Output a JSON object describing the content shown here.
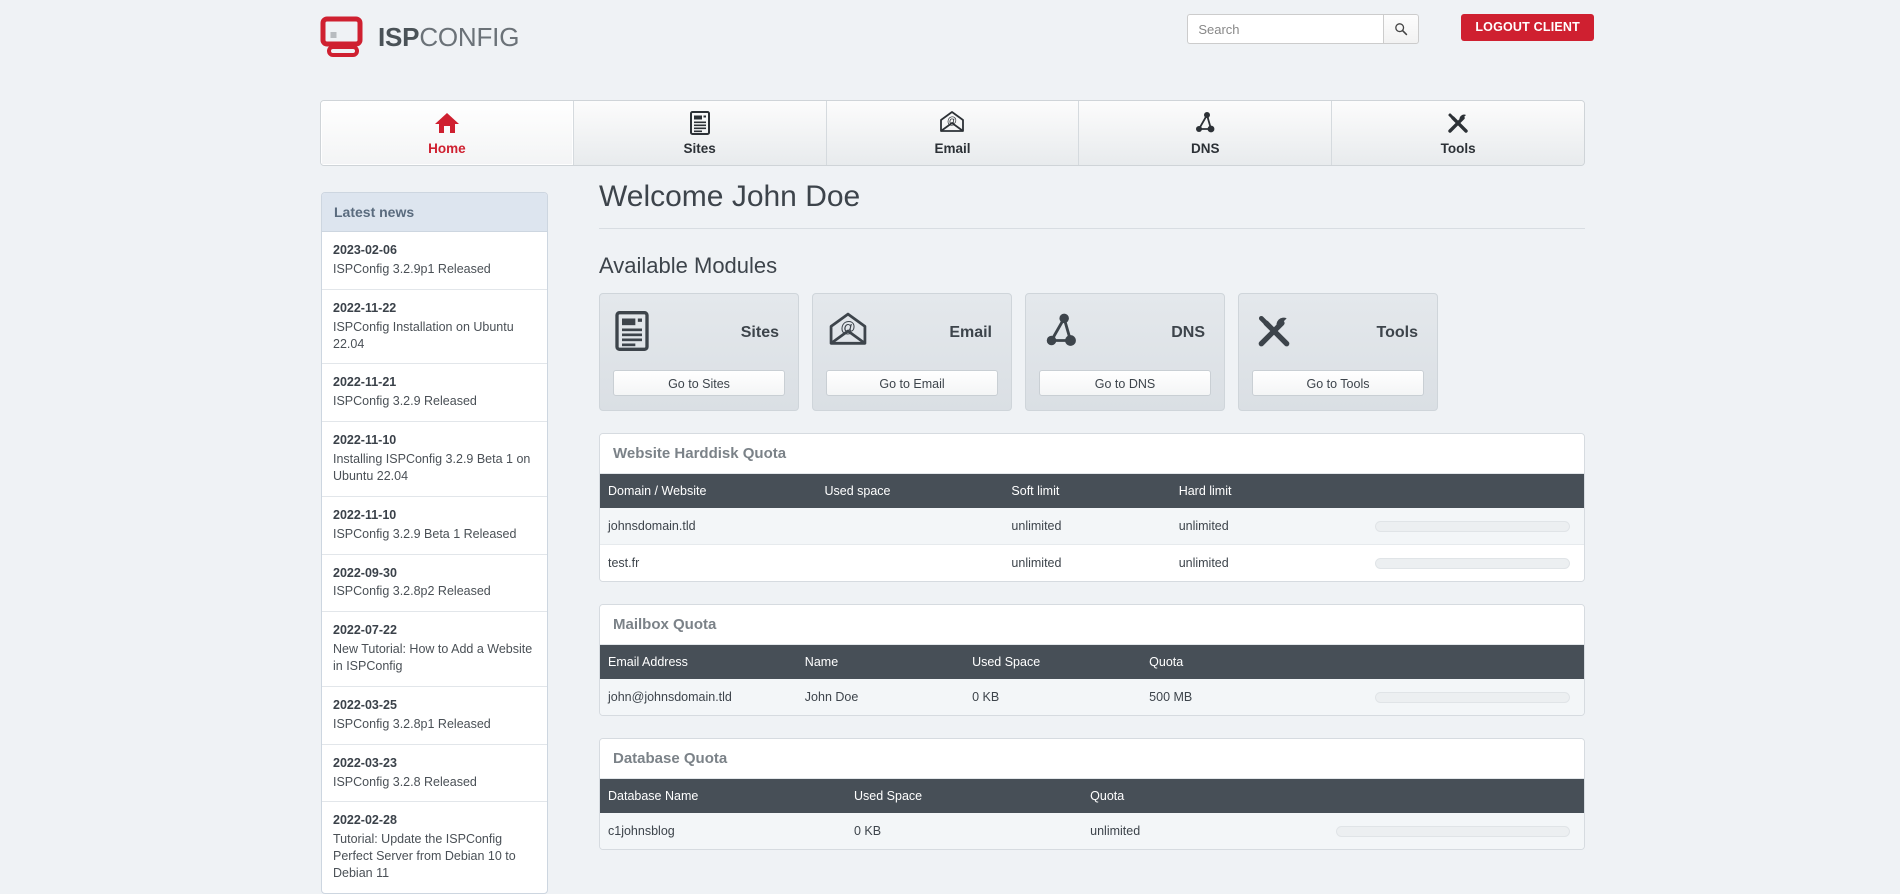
{
  "header": {
    "logo": {
      "icon": "monitor-icon",
      "text_bold": "ISP",
      "text_light": "CONFIG",
      "color": "#cf2030"
    },
    "search": {
      "placeholder": "Search",
      "value": "",
      "button_icon": "search-icon"
    },
    "logout_label": "LOGOUT CLIENT",
    "logout_color": "#cf2030"
  },
  "nav": {
    "tabs": [
      {
        "label": "Home",
        "icon": "home-icon",
        "active": true
      },
      {
        "label": "Sites",
        "icon": "sites-icon",
        "active": false
      },
      {
        "label": "Email",
        "icon": "email-icon",
        "active": false
      },
      {
        "label": "DNS",
        "icon": "dns-icon",
        "active": false
      },
      {
        "label": "Tools",
        "icon": "tools-icon",
        "active": false
      }
    ]
  },
  "sidebar": {
    "title": "Latest news",
    "news": [
      {
        "date": "2023-02-06",
        "title": "ISPConfig 3.2.9p1 Released"
      },
      {
        "date": "2022-11-22",
        "title": "ISPConfig Installation on Ubuntu 22.04"
      },
      {
        "date": "2022-11-21",
        "title": "ISPConfig 3.2.9 Released"
      },
      {
        "date": "2022-11-10",
        "title": "Installing ISPConfig 3.2.9 Beta 1 on Ubuntu 22.04"
      },
      {
        "date": "2022-11-10",
        "title": "ISPConfig 3.2.9 Beta 1 Released"
      },
      {
        "date": "2022-09-30",
        "title": "ISPConfig 3.2.8p2 Released"
      },
      {
        "date": "2022-07-22",
        "title": "New Tutorial: How to Add a Website in ISPConfig"
      },
      {
        "date": "2022-03-25",
        "title": "ISPConfig 3.2.8p1 Released"
      },
      {
        "date": "2022-03-23",
        "title": "ISPConfig 3.2.8 Released"
      },
      {
        "date": "2022-02-28",
        "title": "Tutorial: Update the ISPConfig Perfect Server from Debian 10 to Debian 11"
      }
    ]
  },
  "main": {
    "welcome_title": "Welcome John Doe",
    "modules_title": "Available Modules",
    "modules": [
      {
        "title": "Sites",
        "icon": "sites-icon",
        "button_label": "Go to Sites"
      },
      {
        "title": "Email",
        "icon": "email-icon",
        "button_label": "Go to Email"
      },
      {
        "title": "DNS",
        "icon": "dns-icon",
        "button_label": "Go to DNS"
      },
      {
        "title": "Tools",
        "icon": "tools-icon",
        "button_label": "Go to Tools"
      }
    ],
    "website_quota": {
      "title": "Website Harddisk Quota",
      "columns": [
        "Domain / Website",
        "Used space",
        "Soft limit",
        "Hard limit",
        ""
      ],
      "rows": [
        {
          "domain": "johnsdomain.tld",
          "used": "",
          "soft": "unlimited",
          "hard": "unlimited",
          "percent": 0
        },
        {
          "domain": "test.fr",
          "used": "",
          "soft": "unlimited",
          "hard": "unlimited",
          "percent": 0
        }
      ]
    },
    "mailbox_quota": {
      "title": "Mailbox Quota",
      "columns": [
        "Email Address",
        "Name",
        "Used Space",
        "Quota",
        ""
      ],
      "rows": [
        {
          "email": "john@johnsdomain.tld",
          "name": "John Doe",
          "used": "0 KB",
          "quota": "500 MB",
          "percent": 0
        }
      ]
    },
    "database_quota": {
      "title": "Database Quota",
      "columns": [
        "Database Name",
        "Used Space",
        "Quota",
        ""
      ],
      "rows": [
        {
          "name": "c1johnsblog",
          "used": "0 KB",
          "quota": "unlimited",
          "percent": 0
        }
      ]
    }
  }
}
